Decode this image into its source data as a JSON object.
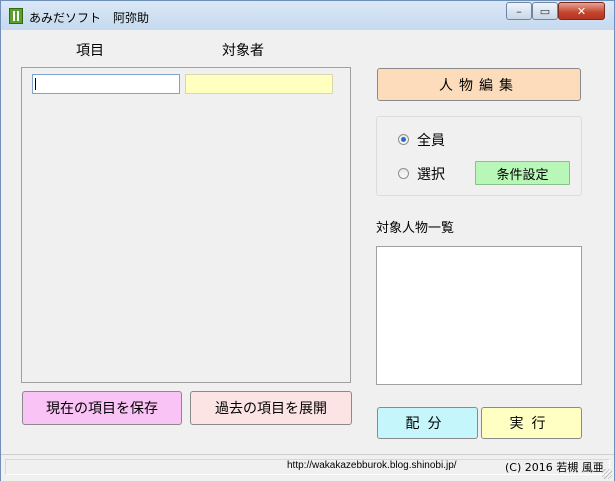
{
  "window": {
    "title": "あみだソフト　阿弥助",
    "minimize": "–",
    "maximize": "▭",
    "close": "✕"
  },
  "columns": {
    "item_header": "項目",
    "target_header": "対象者"
  },
  "inputs": {
    "item_value": "",
    "target_value": ""
  },
  "buttons": {
    "person_edit": "人物編集",
    "save_current": "現在の項目を保存",
    "expand_past": "過去の項目を展開",
    "distribute": "配分",
    "execute": "実行",
    "condition_setting": "条件設定"
  },
  "selection": {
    "all_label": "全員",
    "select_label": "選択",
    "selected": "all"
  },
  "person_list": {
    "label": "対象人物一覧",
    "items": []
  },
  "status": {
    "url": "http://wakakazebburok.blog.shinobi.jp/",
    "copyright": "(C) 2016 若槻 風亜"
  },
  "colors": {
    "target_field": "#ffffc0",
    "person_edit_button": "#fddcbc",
    "save_button": "#fac3f5",
    "expand_button": "#fde4e4",
    "distribute_button": "#c4f6fb",
    "execute_button": "#ffffc4",
    "condition_button": "#b8f7b8"
  },
  "icons": {
    "app": "amida-app-icon"
  }
}
